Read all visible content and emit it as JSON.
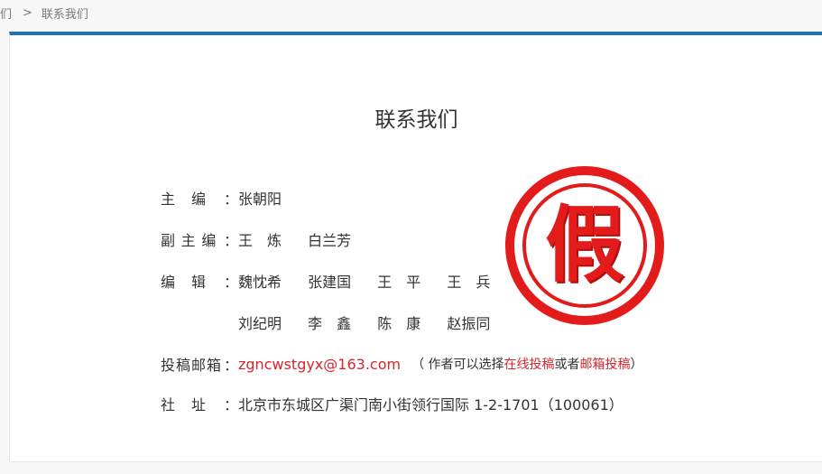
{
  "breadcrumb": {
    "parent": "们",
    "separator": ">",
    "current": "联系我们"
  },
  "page": {
    "title": "联系我们"
  },
  "rows": {
    "editor": {
      "label": [
        "主",
        "编",
        "："
      ],
      "names": [
        "张朝阳"
      ]
    },
    "deputy": {
      "label": [
        "副",
        "主",
        "编",
        "："
      ],
      "names": [
        "王　炼",
        "白兰芳"
      ]
    },
    "editors1": {
      "label": [
        "编",
        "辑",
        "："
      ],
      "names": [
        "魏忱希",
        "张建国",
        "王　平",
        "王　兵"
      ]
    },
    "editors2": {
      "names": [
        "刘纪明",
        "李　鑫",
        "陈　康",
        "赵振同"
      ]
    },
    "submission": {
      "label": [
        "投",
        "稿",
        "邮",
        "箱",
        "："
      ],
      "email": "zgncwstgyx@163.com",
      "note_open": "（ 作者可以选择",
      "online_link": "在线投稿",
      "note_or": "或者",
      "email_link": "邮箱投稿",
      "note_close": "）"
    },
    "address": {
      "label": [
        "社",
        "址",
        "："
      ],
      "value": "北京市东城区广渠门南小街领行国际 1-2-1701（100061）"
    }
  },
  "stamp": {
    "text": "假",
    "color": "#e31b1b"
  },
  "colors": {
    "accent": "#1b73b9",
    "link": "#d7262b"
  }
}
